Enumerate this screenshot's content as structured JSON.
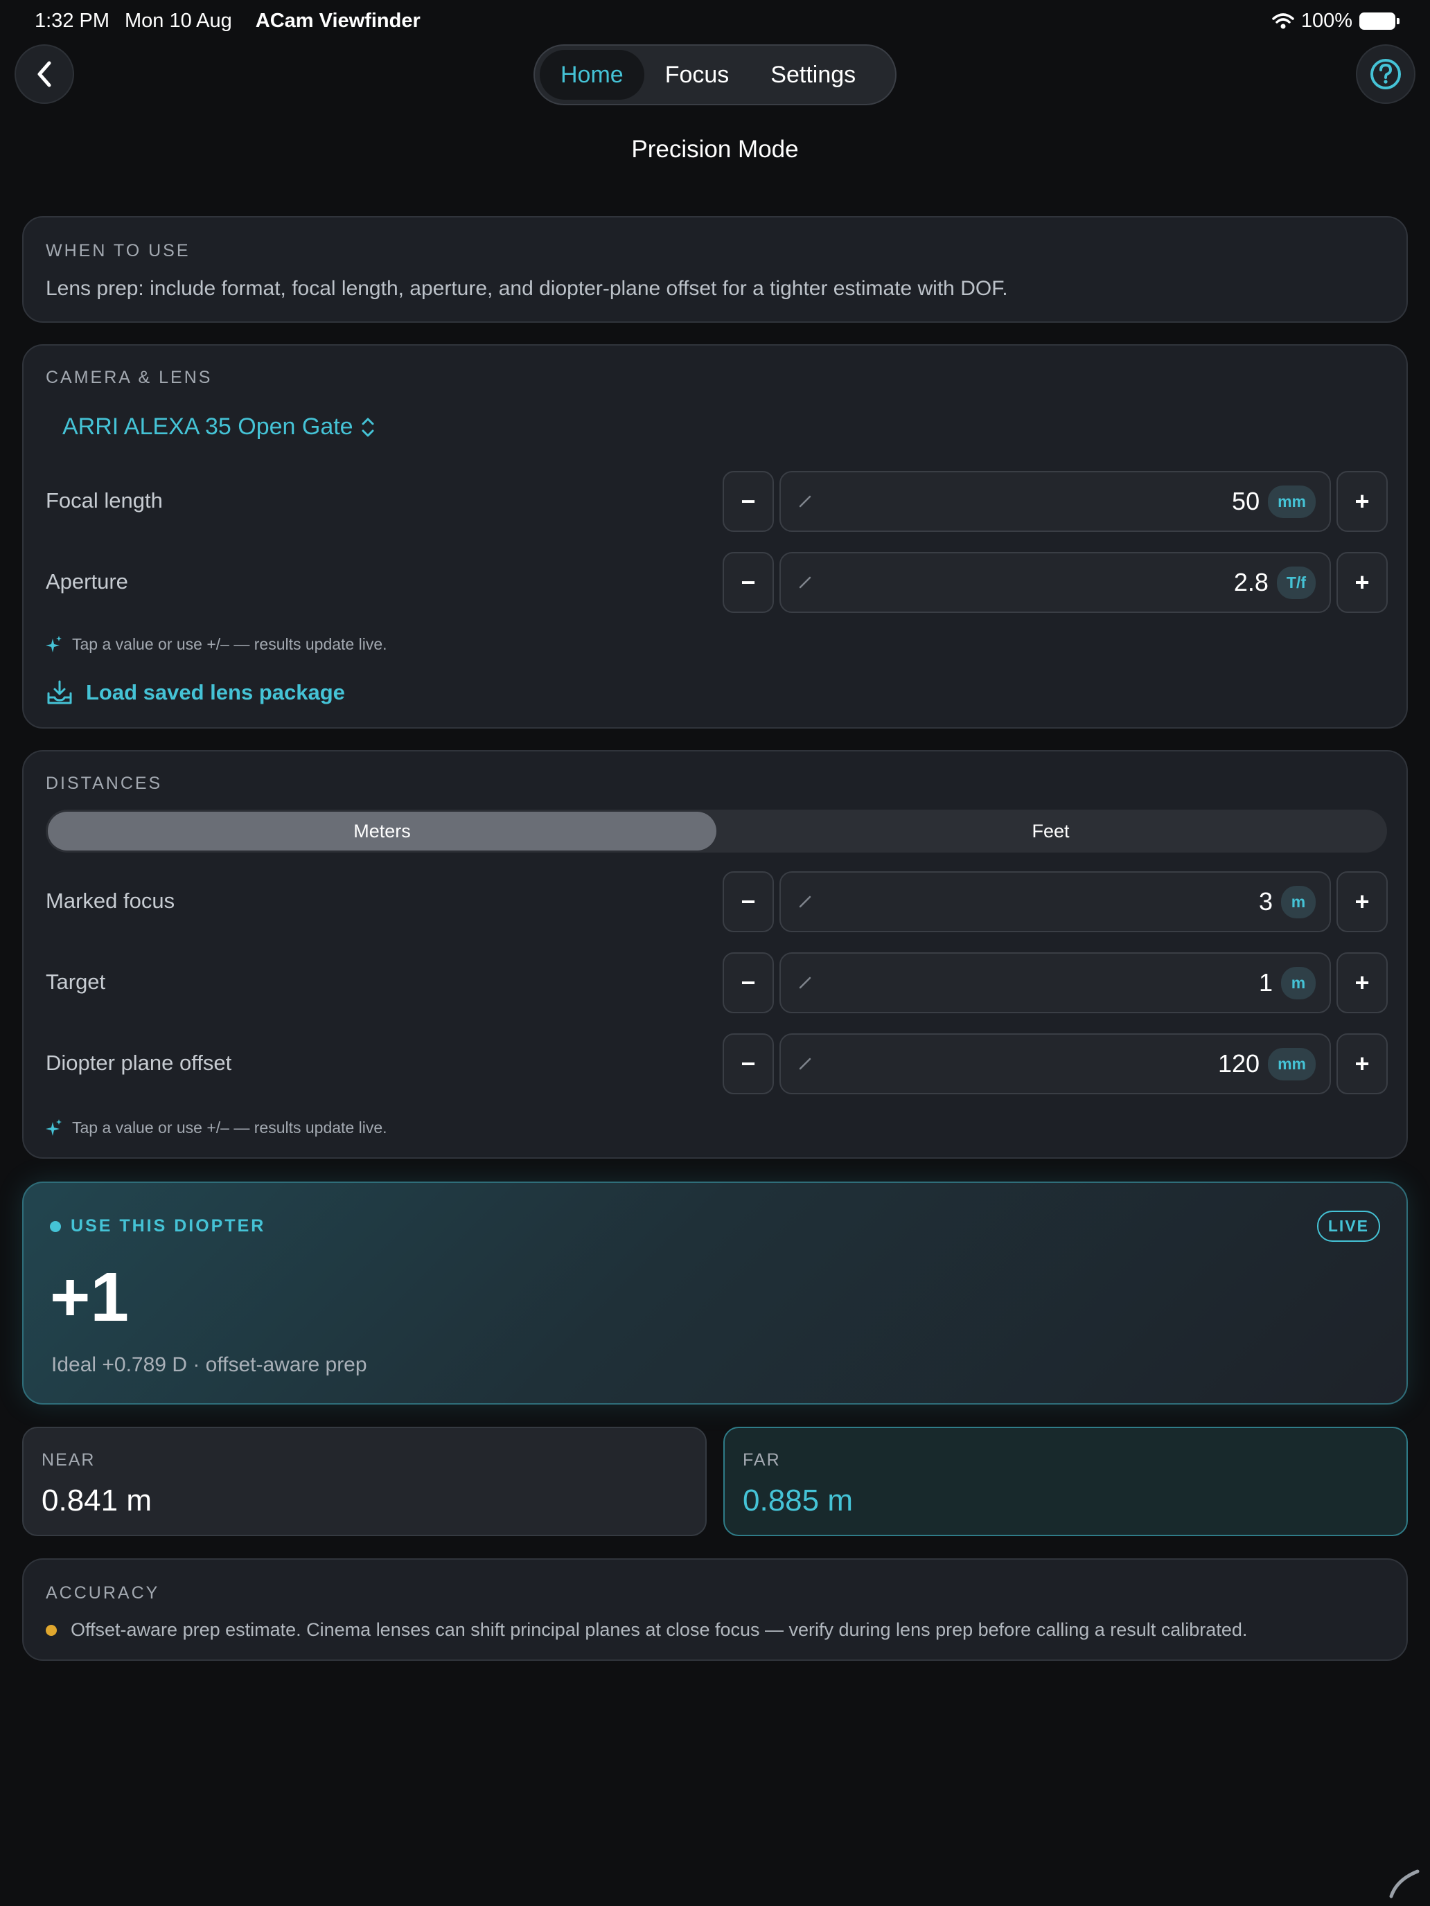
{
  "status": {
    "time": "1:32 PM",
    "date": "Mon 10 Aug",
    "app": "ACam Viewfinder",
    "battery": "100%"
  },
  "nav": {
    "tabs": [
      "Home",
      "Focus",
      "Settings"
    ],
    "active": "Home",
    "title": "Precision Mode"
  },
  "when": {
    "label": "WHEN TO USE",
    "text": "Lens prep: include format, focal length, aperture, and diopter-plane offset for a tighter estimate with DOF."
  },
  "camera": {
    "label": "CAMERA & LENS",
    "preset": "ARRI ALEXA 35 Open Gate",
    "focal": {
      "label": "Focal length",
      "value": "50",
      "unit": "mm"
    },
    "aperture": {
      "label": "Aperture",
      "value": "2.8",
      "unit": "T/f"
    },
    "hint": "Tap a value or use +/– — results update live.",
    "load": "Load saved lens package"
  },
  "distances": {
    "label": "DISTANCES",
    "units": [
      "Meters",
      "Feet"
    ],
    "active_unit": "Meters",
    "marked": {
      "label": "Marked focus",
      "value": "3",
      "unit": "m"
    },
    "target": {
      "label": "Target",
      "value": "1",
      "unit": "m"
    },
    "offset": {
      "label": "Diopter plane offset",
      "value": "120",
      "unit": "mm"
    },
    "hint": "Tap a value or use +/– — results update live."
  },
  "result": {
    "label": "USE THIS DIOPTER",
    "live": "LIVE",
    "value": "+1",
    "ideal": "Ideal +0.789 D · offset-aware prep"
  },
  "near": {
    "label": "NEAR",
    "value": "0.841 m"
  },
  "far": {
    "label": "FAR",
    "value": "0.885 m"
  },
  "accuracy": {
    "label": "ACCURACY",
    "text": "Offset-aware prep estimate. Cinema lenses can shift principal planes at close focus — verify during lens prep before calling a result calibrated."
  },
  "colors": {
    "accent": "#45c3d6",
    "warning": "#e0a72e",
    "background": "#0e0f11"
  }
}
